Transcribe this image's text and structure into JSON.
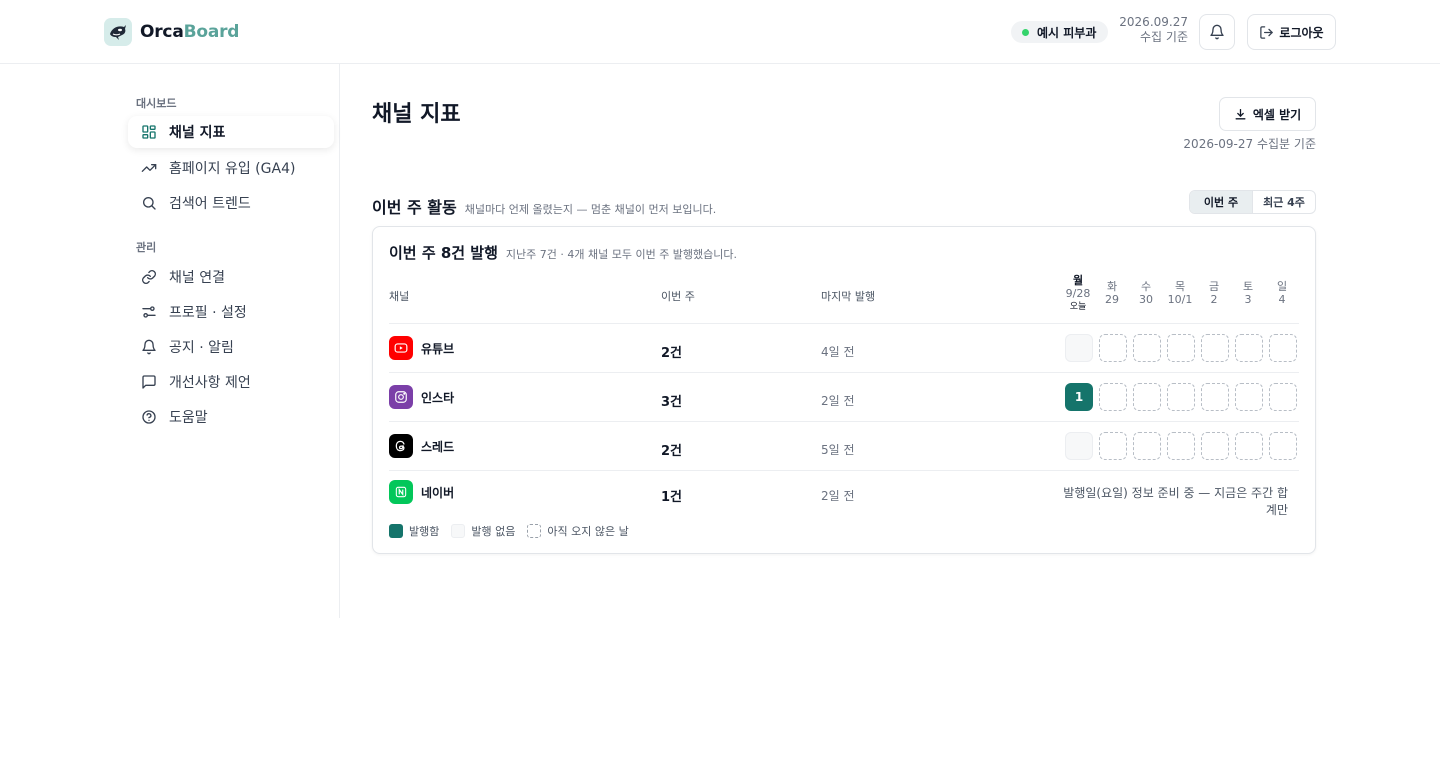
{
  "app": {
    "logo_a": "Orca",
    "logo_b": "Board",
    "clinic": "예시 피부과",
    "collect_date": "2026.09.27",
    "collect_label": "수집 기준",
    "logout": "로그아웃"
  },
  "colors": {
    "accent": "#15746b",
    "status_dot": "#34d36b",
    "youtube": "#ff0000",
    "instagram": "#7b3fa8",
    "threads": "#000000",
    "naver": "#03c75a"
  },
  "sidebar": {
    "section_dashboard": "대시보드",
    "section_manage": "관리",
    "items": [
      {
        "label": "채널 지표",
        "icon": "grid-icon"
      },
      {
        "label": "홈페이지 유입 (GA4)",
        "icon": "trending-up-icon"
      },
      {
        "label": "검색어 트렌드",
        "icon": "search-icon"
      },
      {
        "label": "채널 연결",
        "icon": "link-icon"
      },
      {
        "label": "프로필 · 설정",
        "icon": "sliders-icon"
      },
      {
        "label": "공지 · 알림",
        "icon": "bell-icon"
      },
      {
        "label": "개선사항 제언",
        "icon": "message-icon"
      },
      {
        "label": "도움말",
        "icon": "help-icon"
      }
    ]
  },
  "main": {
    "title": "채널 지표",
    "excel": "엑셀 받기",
    "basis": "2026-09-27 수집분 기준",
    "section_title": "이번 주 활동",
    "section_sub": "채널마다 언제 올렸는지 — 멈춘 채널이 먼저 보입니다.",
    "seg": [
      "이번 주",
      "최근 4주"
    ],
    "card_title": "이번 주 8건 발행",
    "card_sub": "지난주 7건 · 4개 채널 모두 이번 주 발행했습니다.",
    "columns": {
      "channel": "채널",
      "this_week": "이번 주",
      "last": "마지막 발행"
    },
    "days": [
      {
        "d": "월",
        "n": "9/28",
        "tag": "오늘"
      },
      {
        "d": "화",
        "n": "29"
      },
      {
        "d": "수",
        "n": "30"
      },
      {
        "d": "목",
        "n": "10/1"
      },
      {
        "d": "금",
        "n": "2"
      },
      {
        "d": "토",
        "n": "3"
      },
      {
        "d": "일",
        "n": "4"
      }
    ],
    "rows": [
      {
        "name": "유튜브",
        "count": "2건",
        "last": "4일 전",
        "days": [
          "empty",
          "future",
          "future",
          "future",
          "future",
          "future",
          "future"
        ]
      },
      {
        "name": "인스타",
        "count": "3건",
        "last": "2일 전",
        "days": [
          "pub:1",
          "future",
          "future",
          "future",
          "future",
          "future",
          "future"
        ]
      },
      {
        "name": "스레드",
        "count": "2건",
        "last": "5일 전",
        "days": [
          "empty",
          "future",
          "future",
          "future",
          "future",
          "future",
          "future"
        ]
      },
      {
        "name": "네이버",
        "count": "1건",
        "last": "2일 전",
        "note": "발행일(요일) 정보 준비 중 — 지금은 주간 합계만"
      }
    ],
    "legend": [
      "발행함",
      "발행 없음",
      "아직 오지 않은 날"
    ]
  }
}
